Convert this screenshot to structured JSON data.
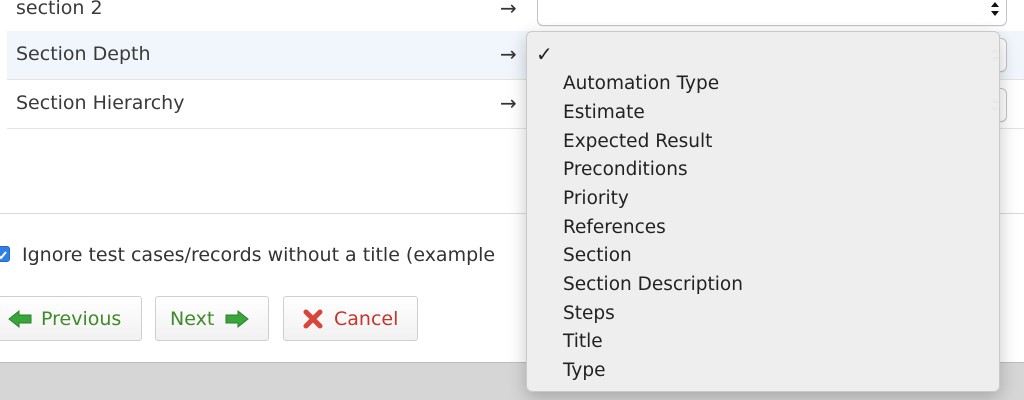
{
  "mapping_rows": [
    {
      "label": "section 2",
      "arrow": "→"
    },
    {
      "label": "Section Depth",
      "arrow": "→"
    },
    {
      "label": "Section Hierarchy",
      "arrow": "→"
    }
  ],
  "options": {
    "ignore_untitled": {
      "label": "Ignore test cases/records without a title (example",
      "checked": true
    }
  },
  "buttons": {
    "previous": "Previous",
    "next": "Next",
    "cancel": "Cancel"
  },
  "dropdown": {
    "checkmark": "✓",
    "items": [
      "Automation Type",
      "Estimate",
      "Expected Result",
      "Preconditions",
      "Priority",
      "References",
      "Section",
      "Section Description",
      "Steps",
      "Title",
      "Type"
    ]
  },
  "colors": {
    "accent_green": "#3f8a2a",
    "accent_red": "#c5352b",
    "checkbox_blue": "#2f7fe5",
    "row_highlight": "#f1f6fd"
  }
}
